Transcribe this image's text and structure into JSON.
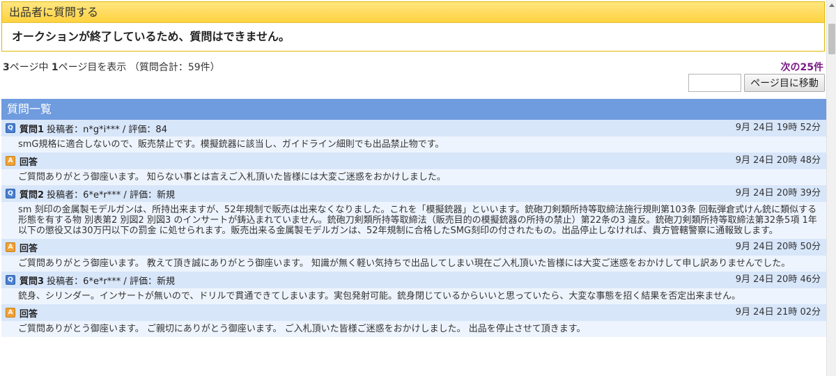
{
  "ask": {
    "header": "出品者に質問する",
    "message": "オークションが終了しているため、質問はできません。"
  },
  "paging": {
    "total_pages": "3",
    "mid1": "ページ中 ",
    "current_page": "1",
    "mid2": "ページ目を表示 （質問合計：59件）",
    "next_label": "次の25件",
    "page_input_value": "",
    "go_label": "ページ目に移動"
  },
  "list": {
    "header": "質問一覧",
    "entries": [
      {
        "q_badge": "Q",
        "q_label": "質問1",
        "q_meta": " 投稿者：n*g*i*** / 評価：84",
        "q_date": "9月 24日 19時 52分",
        "q_text": "smG規格に適合しないので、販売禁止です。模擬銃器に該当し、ガイドライン細則でも出品禁止物です。",
        "a_badge": "A",
        "a_label": "回答",
        "a_date": "9月 24日 20時 48分",
        "a_text": "ご質問ありがとう御座います。 知らない事とは言えご入札頂いた皆様には大変ご迷惑をおかけしました。"
      },
      {
        "q_badge": "Q",
        "q_label": "質問2",
        "q_meta": " 投稿者：6*e*r*** / 評価：新規",
        "q_date": "9月 24日 20時 39分",
        "q_text": "sm 刻印の金属製モデルガンは、所持出来ますが、52年規制で販売は出来なくなりました。これを「模擬銃器」といいます。銃砲刀剣類所持等取締法施行規則第103条 回転弾倉式けん銃に類似する形態を有する物 別表第2 別図2 別図3 のインサートが鋳込まれていません。銃砲刀剣類所持等取締法（販売目的の模擬銃器の所持の禁止）第22条の3 違反。銃砲刀剣類所持等取締法第32条5項 1年以下の懲役又は30万円以下の罰金 に処せられます。販売出来る金属製モデルガンは、52年規制に合格したSMG刻印の付されたもの。出品停止しなければ、貴方管轄警察に通報致します。",
        "a_badge": "A",
        "a_label": "回答",
        "a_date": "9月 24日 20時 50分",
        "a_text": "ご質問ありがとう御座います。 教えて頂き誠にありがとう御座います。 知識が無く軽い気持ちで出品してしまい現在ご入札頂いた皆様には大変ご迷惑をおかけして申し訳ありませんでした。"
      },
      {
        "q_badge": "Q",
        "q_label": "質問3",
        "q_meta": " 投稿者：6*e*r*** / 評価：新規",
        "q_date": "9月 24日 20時 46分",
        "q_text": "銃身、シリンダー。インサートが無いので、ドリルで貫通できてしまいます。実包発射可能。銃身閉じているからいいと思っていたら、大変な事態を招く結果を否定出来ません。",
        "a_badge": "A",
        "a_label": "回答",
        "a_date": "9月 24日 21時 02分",
        "a_text": "ご質問ありがとう御座います。 ご親切にありがとう御座います。 ご入札頂いた皆様ご迷惑をおかけしました。 出品を停止させて頂きます。"
      }
    ]
  },
  "colors": {
    "header_yellow": "#ffd23f",
    "list_header_blue": "#6f9bdf",
    "row_head_bg": "#d8e6fa",
    "row_body_bg": "#eef4fd",
    "next_link": "#7a1a86",
    "q_badge": "#4a7fd0",
    "a_badge": "#f0a23a"
  }
}
